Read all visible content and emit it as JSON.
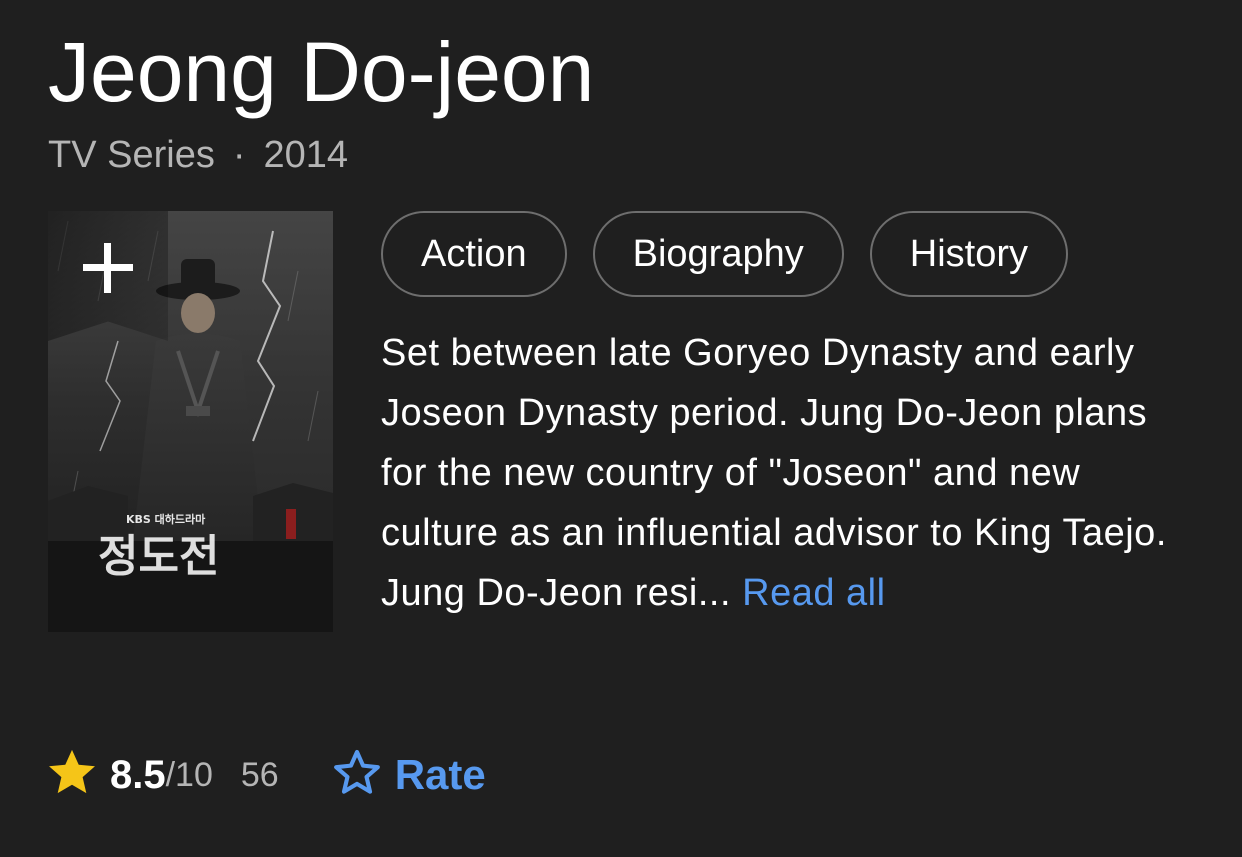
{
  "title": "Jeong Do-jeon",
  "meta": {
    "type": "TV Series",
    "separator": "·",
    "year": "2014"
  },
  "poster": {
    "add_icon": "plus-icon",
    "broadcaster": "KBS 대하드라마",
    "calligraphy": "정도전"
  },
  "genres": [
    "Action",
    "Biography",
    "History"
  ],
  "plot": {
    "text": "Set between late Goryeo Dynasty and early Joseon Dynasty period. Jung Do-Jeon plans for the new country of \"Joseon\" and new culture as an influential advisor to King Taejo. Jung Do-Jeon resi...",
    "read_all": "Read all"
  },
  "rating": {
    "star_icon": "star-filled-icon",
    "score": "8.5",
    "out_of": "/10",
    "votes": "56"
  },
  "rate": {
    "icon": "star-outline-icon",
    "label": "Rate"
  },
  "colors": {
    "background": "#1f1f1f",
    "accent_blue": "#5799ef",
    "star_yellow": "#f5c518",
    "muted_text": "#b5b5b5"
  }
}
